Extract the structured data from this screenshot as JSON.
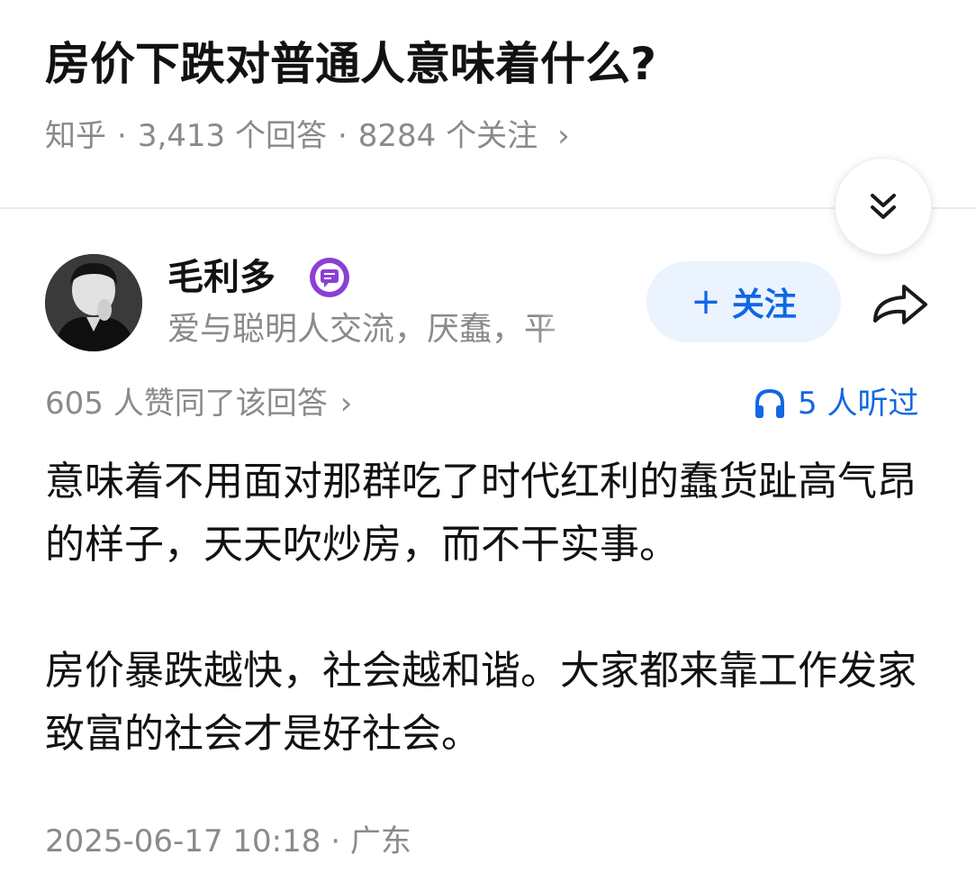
{
  "question": {
    "title": "房价下跌对普通人意味着什么?",
    "source": "知乎",
    "separator": "·",
    "answers": "3,413 个回答",
    "followers": "8284 个关注",
    "chevron": "›"
  },
  "controls": {
    "collapse_icon": "double-chevron-down-icon",
    "share_icon": "share-arrow-icon"
  },
  "author": {
    "name": "毛利多",
    "badge_icon": "verified-badge-icon",
    "bio": "爱与聪明人交流，厌蠢，平",
    "follow_plus": "+",
    "follow_label": "关注"
  },
  "stats": {
    "upvotes": "605 人赞同了该回答",
    "chevron": "›",
    "listen_icon": "headphones-icon",
    "listeners": "5 人听过"
  },
  "answer": {
    "paragraphs": [
      "意味着不用面对那群吃了时代红利的蠢货趾高气昂的样子，天天吹炒房，而不干实事。",
      "房价暴跌越快，社会越和谐。大家都来靠工作发家致富的社会才是好社会。"
    ]
  },
  "footer": {
    "datetime": "2025-06-17 10:18",
    "separator": "·",
    "location": "广东"
  },
  "colors": {
    "accent_blue": "#0f66e6",
    "follow_bg": "#ebf4fe",
    "meta_gray": "#8a8a8a",
    "badge_purple": "#8b3fd6"
  }
}
